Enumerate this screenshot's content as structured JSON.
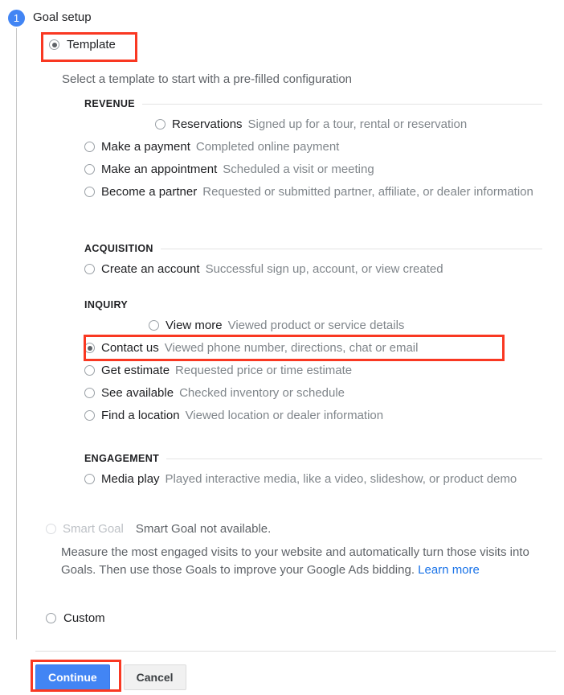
{
  "step": {
    "number": "1",
    "title": "Goal setup"
  },
  "template": {
    "label": "Template",
    "helper": "Select a template to start with a pre-filled configuration",
    "selected": true
  },
  "sections": [
    {
      "id": "revenue",
      "heading": "REVENUE",
      "rule": true,
      "options": [
        {
          "label": "Reservations",
          "desc": "Signed up for a tour, rental or reservation",
          "indent": "far",
          "checked": false
        },
        {
          "label": "Make a payment",
          "desc": "Completed online payment",
          "indent": "none",
          "checked": false
        },
        {
          "label": "Make an appointment",
          "desc": "Scheduled a visit or meeting",
          "indent": "none",
          "checked": false
        },
        {
          "label": "Become a partner",
          "desc": "Requested or submitted partner, affiliate, or dealer information",
          "indent": "none",
          "checked": false
        }
      ]
    },
    {
      "id": "acquisition",
      "heading": "ACQUISITION",
      "rule": true,
      "options": [
        {
          "label": "Create an account",
          "desc": "Successful sign up, account, or view created",
          "indent": "none",
          "checked": false
        }
      ]
    },
    {
      "id": "inquiry",
      "heading": "INQUIRY",
      "rule": false,
      "options": [
        {
          "label": "View more",
          "desc": "Viewed product or service details",
          "indent": "mid",
          "checked": false
        },
        {
          "label": "Contact us",
          "desc": "Viewed phone number, directions, chat or email",
          "indent": "none",
          "checked": true
        },
        {
          "label": "Get estimate",
          "desc": "Requested price or time estimate",
          "indent": "none",
          "checked": false
        },
        {
          "label": "See available",
          "desc": "Checked inventory or schedule",
          "indent": "none",
          "checked": false
        },
        {
          "label": "Find a location",
          "desc": "Viewed location or dealer information",
          "indent": "none",
          "checked": false
        }
      ]
    },
    {
      "id": "engagement",
      "heading": "ENGAGEMENT",
      "rule": true,
      "options": [
        {
          "label": "Media play",
          "desc": "Played interactive media, like a video, slideshow, or product demo",
          "indent": "none",
          "checked": false
        }
      ]
    }
  ],
  "smart_goal": {
    "label": "Smart Goal",
    "status": "Smart Goal not available.",
    "paragraph": "Measure the most engaged visits to your website and automatically turn those visits into Goals. Then use those Goals to improve your Google Ads bidding.",
    "link": "Learn more",
    "disabled": true
  },
  "custom": {
    "label": "Custom",
    "selected": false
  },
  "footer": {
    "continue_label": "Continue",
    "cancel_label": "Cancel"
  },
  "highlights": {
    "color": "#f93822",
    "targets": [
      "Template",
      "Contact us",
      "Continue"
    ]
  }
}
